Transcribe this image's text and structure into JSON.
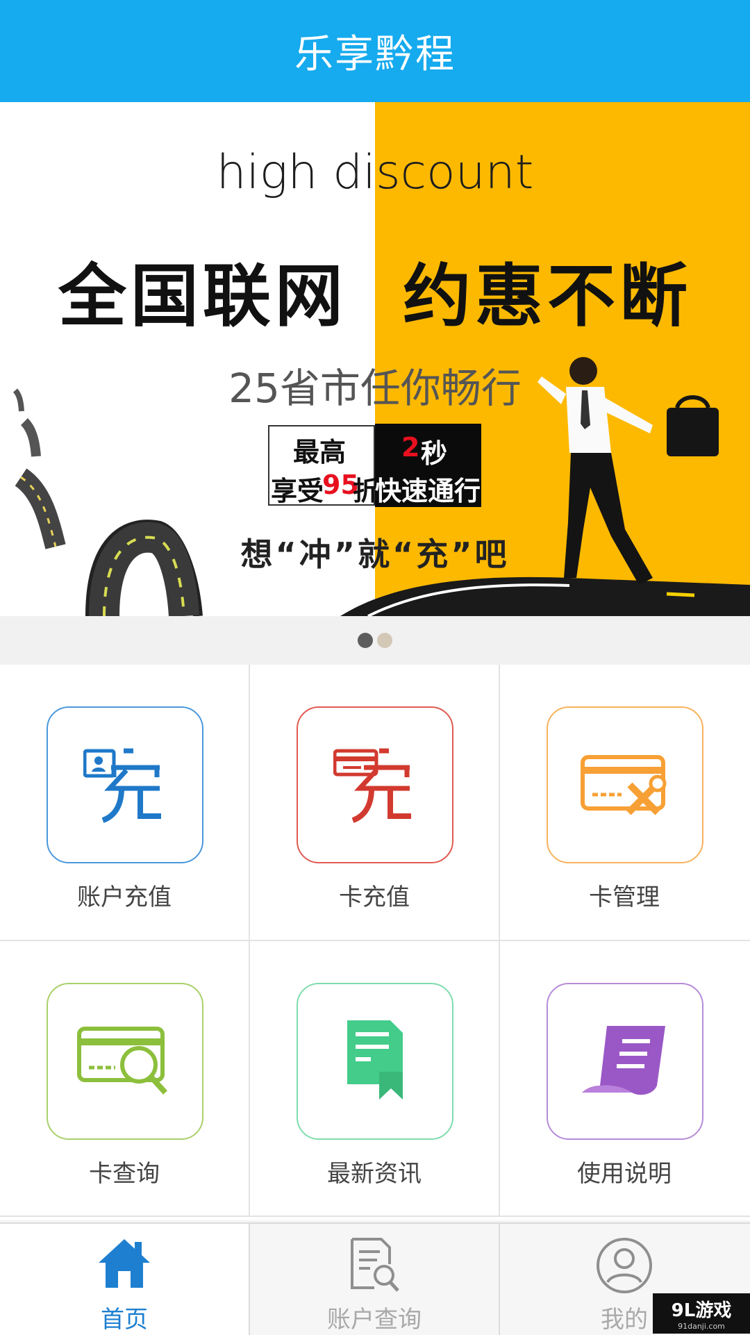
{
  "header": {
    "title": "乐享黔程"
  },
  "banner": {
    "tagline": "high discount",
    "headline": "全国联网  约惠不断",
    "subline": "25省市任你畅行",
    "box_top_left": "最高",
    "box_bottom_left_a": "享受",
    "box_bottom_left_b": "95",
    "box_bottom_left_c": "折",
    "box_top_right_a": "2",
    "box_top_right_b": "秒",
    "box_bottom_right": "快速通行",
    "slogan": "想“冲”就“充”吧",
    "colors": {
      "accent_yellow": "#fdb900",
      "highlight_red": "#e8101f"
    }
  },
  "carousel": {
    "count": 2,
    "active_index": 0
  },
  "grid": {
    "items": [
      {
        "label": "账户充值",
        "icon": "account-recharge-icon",
        "color": "#1f78c8"
      },
      {
        "label": "卡充值",
        "icon": "card-recharge-icon",
        "color": "#d23a2f"
      },
      {
        "label": "卡管理",
        "icon": "card-manage-icon",
        "color": "#f7a035"
      },
      {
        "label": "卡查询",
        "icon": "card-query-icon",
        "color": "#8cbf3c"
      },
      {
        "label": "最新资讯",
        "icon": "news-icon",
        "color": "#43cc8a"
      },
      {
        "label": "使用说明",
        "icon": "instructions-icon",
        "color": "#9a58c6"
      }
    ]
  },
  "tabbar": {
    "tabs": [
      {
        "label": "首页",
        "icon": "home-icon",
        "active": true
      },
      {
        "label": "账户查询",
        "icon": "account-query-icon",
        "active": false
      },
      {
        "label": "我的",
        "icon": "profile-icon",
        "active": false
      }
    ],
    "colors": {
      "active": "#1e7fd0",
      "inactive": "#a9a9a9"
    }
  },
  "watermark": {
    "logo": "9L游戏",
    "url": "91danji.com"
  }
}
